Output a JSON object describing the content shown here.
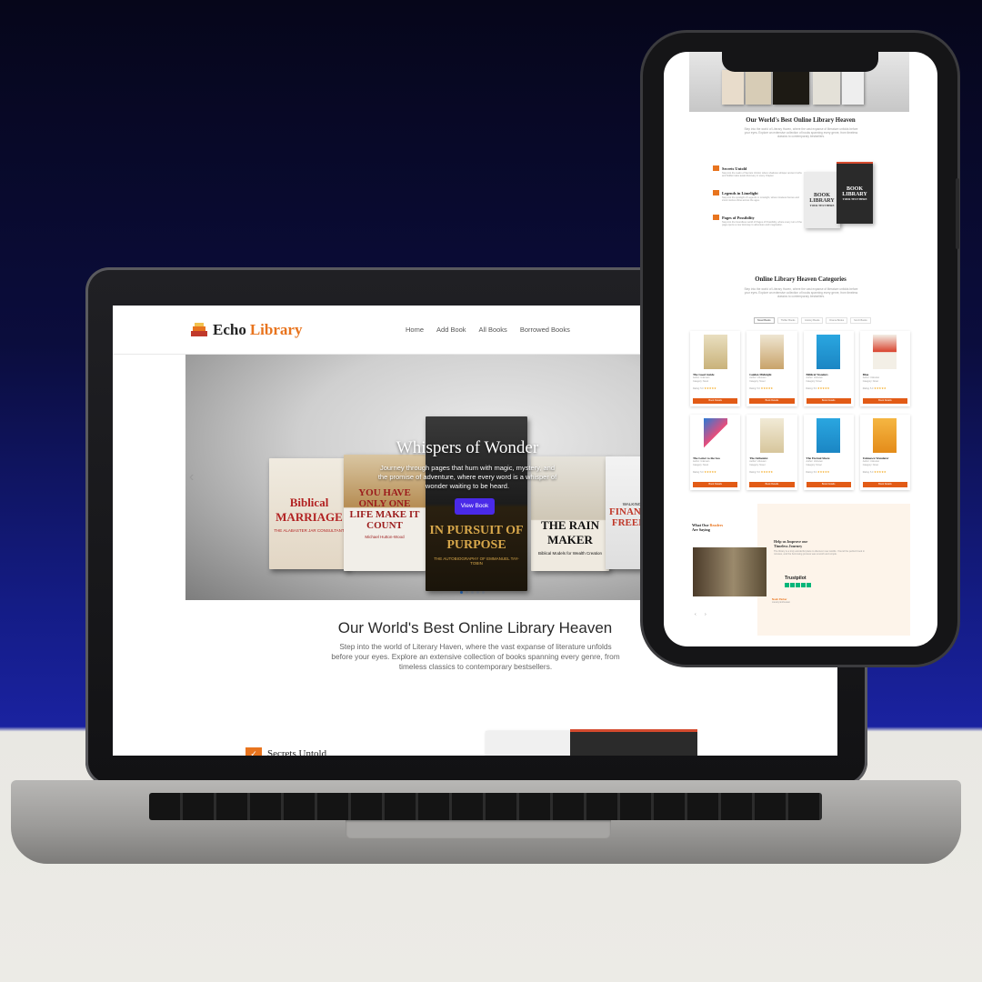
{
  "laptop": {
    "logo": {
      "part1": "Echo",
      "part2": "Library"
    },
    "nav": [
      "Home",
      "Add Book",
      "All Books",
      "Borrowed Books"
    ],
    "hero": {
      "title": "Whispers of Wonder",
      "subtitle": "Journey through pages that hum with magic, mystery, and the promise of adventure, where every word is a whisper of wonder waiting to be heard.",
      "button": "View Book",
      "prev_icon": "chevron-left-icon",
      "books": [
        {
          "title": "Biblical MARRIAGE",
          "sub": "THE ALABASTER JAR CONSULTANT"
        },
        {
          "title": "YOU HAVE ONLY ONE LIFE MAKE IT COUNT",
          "sub": "Michael Hutton-Wood"
        },
        {
          "title": "IN PURSUIT OF PURPOSE",
          "sub": "THE AUTOBIOGRAPHY OF EMMANUEL TAY-TOBIN"
        },
        {
          "title": "THE RAIN MAKER",
          "sub": "Biblical Models for Wealth Creation"
        },
        {
          "title": "FINANCIAL FREEDOM",
          "sub": "WALKING INTO"
        }
      ]
    },
    "section": {
      "heading": "Our World's Best Online Library Heaven",
      "paragraph": "Step into the world of Literary Haven, where the vast expanse of literature unfolds before your eyes. Explore an extensive collection of books spanning every genre, from timeless classics to contemporary bestsellers."
    },
    "feature": {
      "icon": "check-icon",
      "label": "Secrets Untold"
    }
  },
  "phone": {
    "heading": "Our World's Best Online Library Heaven",
    "paragraph": "Step into the world of Literary Haven, where the vast expanse of literature unfolds before your eyes. Explore an extensive collection of books spanning every genre, from timeless classics to contemporary bestsellers.",
    "features": [
      {
        "title": "Secrets Untold",
        "text": "Step into the realm of Secrets Untold, where shadows whisper ancient truths and hidden tales await discovery in every chapter."
      },
      {
        "title": "Legends in Limelight",
        "text": "Step into the spotlight of Legends in Limelight, where timeless heroes and iconic stories shine across the ages."
      },
      {
        "title": "Pages of Possibility",
        "text": "Step into the boundless world of Pages of Possibility, where every turn of the page opens a new doorway to adventure and imagination."
      }
    ],
    "mock_book": {
      "line1": "BOOK",
      "line2": "LIBRARY",
      "line3": "YOUR TEXT HERE"
    },
    "categories_heading": "Online Library Heaven Categories",
    "categories_paragraph": "Step into the world of Literary Haven, where the vast expanse of literature unfolds before your eyes. Explore an extensive collection of books spanning every genre, from timeless classics to contemporary bestsellers.",
    "tabs": [
      "Novel Books",
      "Thriller Books",
      "History Books",
      "Drama Books",
      "Sci-Fi Books"
    ],
    "cards": [
      {
        "title": "The Good Guide",
        "author": "Author: Unknown",
        "category": "Category: Novel",
        "rating": "Rating: 5.0",
        "stars": "★★★★★",
        "button": "Book Details"
      },
      {
        "title": "Golden Midnight",
        "author": "Author: Unknown",
        "category": "Category: Novel",
        "rating": "Rating: 5.0",
        "stars": "★★★★★",
        "button": "Book Details"
      },
      {
        "title": "Biblical Wonders",
        "author": "Author: Unknown",
        "category": "Category: Novel",
        "rating": "Rating: 5.0",
        "stars": "★★★★★",
        "button": "Book Details"
      },
      {
        "title": "Blue",
        "author": "Author: Unknown",
        "category": "Category: Novel",
        "rating": "Rating: 5.0",
        "stars": "★★★★★",
        "button": "Book Details"
      },
      {
        "title": "The Letter to the Sea",
        "author": "Author: Unknown",
        "category": "Category: Novel",
        "rating": "Rating: 5.0",
        "stars": "★★★★★",
        "button": "Book Details"
      },
      {
        "title": "The Alchemist",
        "author": "Author: Unknown",
        "category": "Category: Novel",
        "rating": "Rating: 5.0",
        "stars": "★★★★★",
        "button": "Book Details"
      },
      {
        "title": "The Eternal Shore",
        "author": "Author: Unknown",
        "category": "Category: Novel",
        "rating": "Rating: 5.0",
        "stars": "★★★★★",
        "button": "Book Details"
      },
      {
        "title": "Unknown Wanderer",
        "author": "Author: Unknown",
        "category": "Category: Novel",
        "rating": "Rating: 5.0",
        "stars": "★★★★★",
        "button": "Book Details"
      }
    ],
    "readers": {
      "line1": "What Our",
      "highlight": "Readers",
      "line2": "Are Saying"
    },
    "review": {
      "title1": "Help us Improve our",
      "title2": "Timeless Journey",
      "text": "The library is a truly wonderful place to discover new worlds. I found the perfect book in minutes, and the borrowing process was smooth and simple.",
      "trust": "Trustpilot",
      "author": "Noah Parker",
      "author_role": "Literary Enthusiast"
    },
    "carousel_nav": "‹ ›"
  }
}
